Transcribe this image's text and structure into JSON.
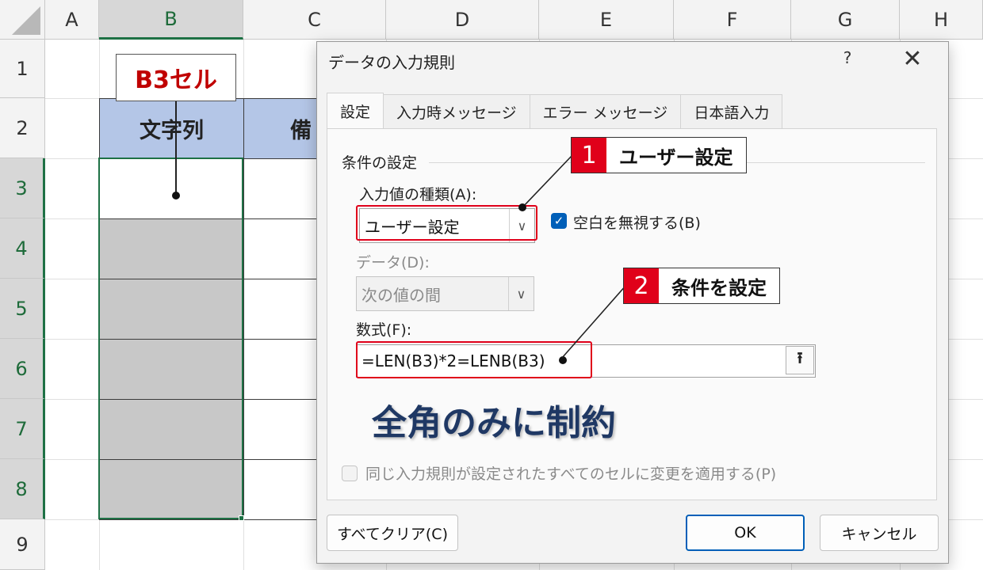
{
  "sheet": {
    "columns": [
      "A",
      "B",
      "C",
      "D",
      "E",
      "F",
      "G",
      "H"
    ],
    "rows": [
      "1",
      "2",
      "3",
      "4",
      "5",
      "6",
      "7",
      "8",
      "9"
    ],
    "selected_column": "B",
    "header_cells": {
      "b2": "文字列",
      "c2": "備"
    },
    "callout_b3": "B3セル"
  },
  "dialog": {
    "title": "データの入力規則",
    "help": "?",
    "close": "✕",
    "tabs": [
      "設定",
      "入力時メッセージ",
      "エラー メッセージ",
      "日本語入力"
    ],
    "active_tab": "設定",
    "section_label": "条件の設定",
    "allow_label": "入力値の種類(A):",
    "allow_value": "ユーザー設定",
    "ignore_blank_label": "空白を無視する(B)",
    "ignore_blank_checked": true,
    "data_label": "データ(D):",
    "data_value": "次の値の間",
    "formula_label": "数式(F):",
    "formula_value": "=LEN(B3)*2=LENB(B3)",
    "apply_all_label": "同じ入力規則が設定されたすべてのセルに変更を適用する(P)",
    "apply_all_checked": false,
    "clear_all_button": "すべてクリア(C)",
    "ok_button": "OK",
    "cancel_button": "キャンセル"
  },
  "annotations": {
    "step1_number": "1",
    "step1_text": "ユーザー設定",
    "step2_number": "2",
    "step2_text": "条件を設定",
    "note": "全角のみに制約"
  },
  "colors": {
    "header_fill": "#b4c6e7",
    "input_cell_fill": "#c8c8c8",
    "highlight_red": "#e0001a",
    "note_navy": "#1f3864",
    "selection_green": "#1e7145"
  }
}
